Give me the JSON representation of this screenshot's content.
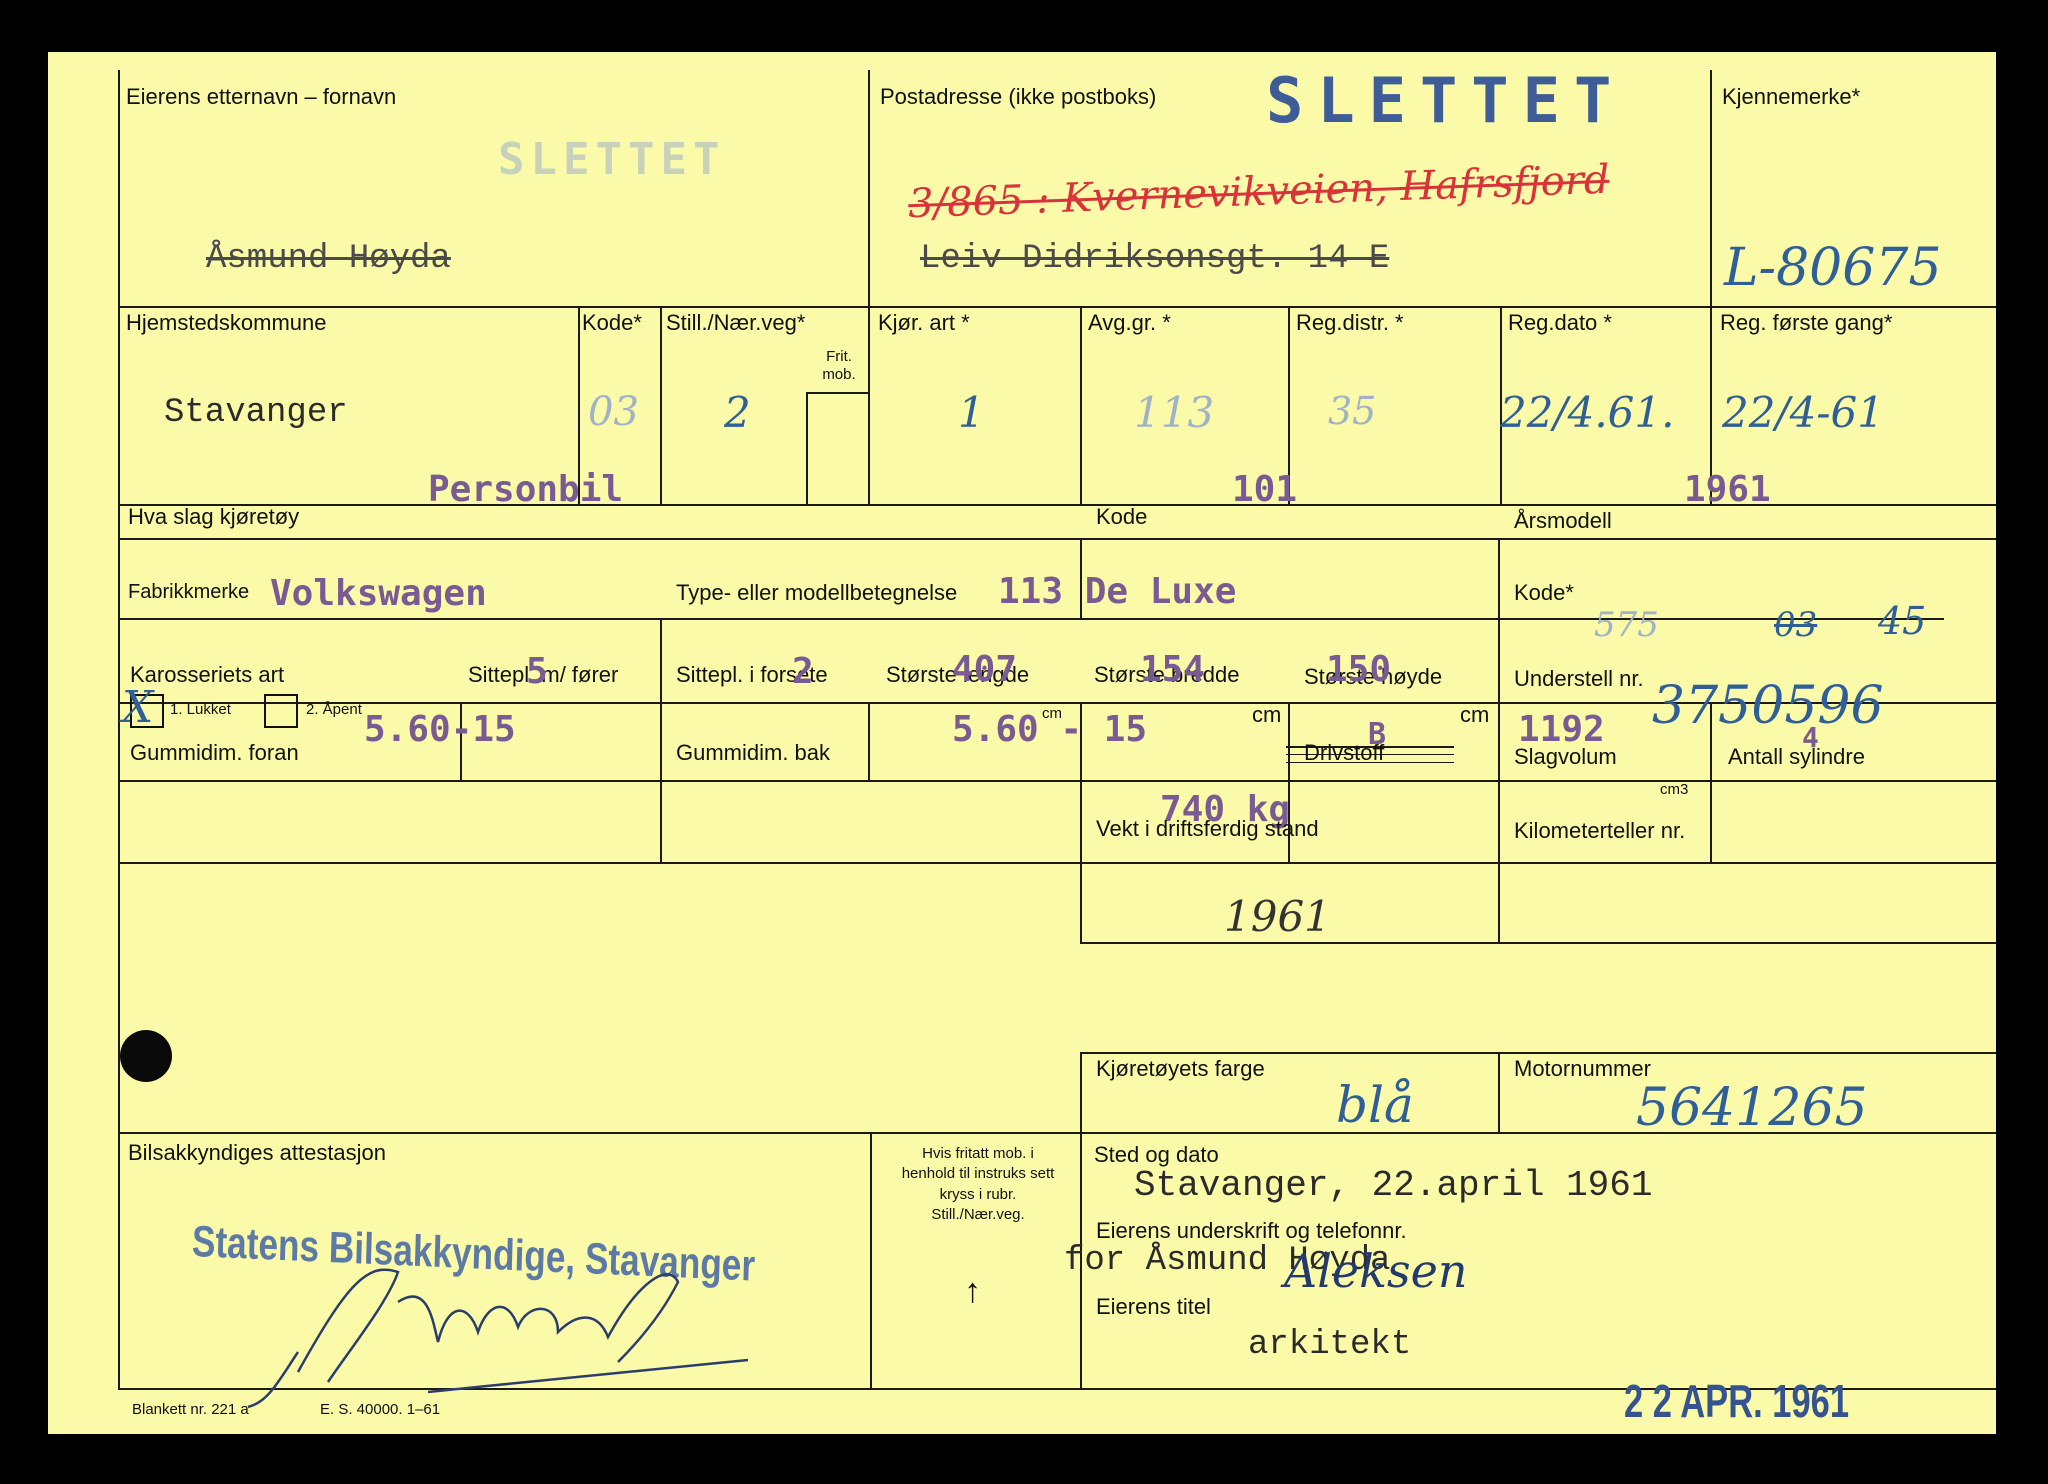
{
  "stamp_title": "SLETTET",
  "faded_stamp": "SLETTET",
  "owner": {
    "label": "Eierens etternavn – fornavn",
    "name": "Åsmund Høyda"
  },
  "address": {
    "label": "Postadresse (ikke postboks)",
    "handwritten": "3/865 : Kvernevikveien, Hafrsfjord",
    "typed": "Leiv Didriksonsgt. 14 E"
  },
  "plate": {
    "label": "Kjennemerke*",
    "value": "L-80675"
  },
  "row2": {
    "hjemsted_label": "Hjemstedskommune",
    "hjemsted_value": "Stavanger",
    "kode_label": "Kode*",
    "kode_value": "03",
    "still_label": "Still./Nær.veg*",
    "still_value": "2",
    "frit_label": "Frit. mob.",
    "kjor_label": "Kjør. art *",
    "kjor_value": "1",
    "avg_label": "Avg.gr. *",
    "avg_value": "113",
    "regdistr_label": "Reg.distr. *",
    "regdistr_value": "35",
    "regdato_label": "Reg.dato *",
    "regdato_value": "22/4.61.",
    "regforste_label": "Reg. første gang*",
    "regforste_value": "22/4-61"
  },
  "vehicle": {
    "kind_label": "Hva slag kjøretøy",
    "kind_value": "Personbil",
    "kode_label": "Kode",
    "kode_value": "101",
    "arsmodell_label": "Årsmodell",
    "arsmodell_value": "1961",
    "fabrikk_label": "Fabrikkmerke",
    "fabrikk_value": "Volkswagen",
    "type_label": "Type- eller modellbetegnelse",
    "type_value": "113 De Luxe",
    "kode2_label": "Kode*",
    "kode2_faint": "575",
    "kode2_struck": "03",
    "kode2_value": "45",
    "karosseri_label": "Karosseriets art",
    "lukket_label": "1. Lukket",
    "lukket_mark": "X",
    "apent_label": "2. Åpent",
    "sittepl_label": "Sittepl. m/ fører",
    "sittepl_value": "5",
    "sittepl_forsete_label": "Sittepl. i forsete",
    "sittepl_forsete_value": "2",
    "lengde_label": "Største lengde",
    "lengde_value": "407",
    "bredde_label": "Største bredde",
    "bredde_value": "154",
    "hoyde_label": "Største høyde",
    "hoyde_value": "150",
    "cm": "cm",
    "understell_label": "Understell nr.",
    "understell_value": "3750596",
    "gummi_foran_label": "Gummidim. foran",
    "gummi_foran_value": "5.60-15",
    "gummi_bak_label": "Gummidim. bak",
    "gummi_bak_value": "5.60 - 15",
    "drivstoff_label": "Drivstoff",
    "drivstoff_value": "B",
    "slagvolum_label": "Slagvolum",
    "slagvolum_value": "1192",
    "cm3": "cm3",
    "sylindre_label": "Antall sylindre",
    "sylindre_value": "4",
    "vekt_value": "740 kg",
    "vekt_label": "Vekt i driftsferdig stand",
    "km_label": "Kilometerteller nr.",
    "year_hand": "1961"
  },
  "lower": {
    "farge_label": "Kjøretøyets farge",
    "farge_value": "blå",
    "motor_label": "Motornummer",
    "motor_value": "5641265",
    "attest_label": "Bilsakkyndiges attestasjon",
    "attest_stamp": "Statens Bilsakkyndige, Stavanger",
    "fritatt_note": "Hvis fritatt mob. i henhold til instruks sett kryss i rubr. Still./Nær.veg.",
    "arrow": "↑",
    "sted_label": "Sted og dato",
    "sted_value": "Stavanger, 22.april 1961",
    "underskrift_label": "Eierens underskrift og telefonnr.",
    "underskrift_value": "for Åsmund Høyda",
    "underskrift_hand": "Aleksen",
    "titel_label": "Eierens titel",
    "titel_value": "arkitekt",
    "blankett": "Blankett nr. 221 a",
    "print_code": "E. S. 40000. 1–61",
    "date_stamp": "2 2 APR. 1961"
  }
}
